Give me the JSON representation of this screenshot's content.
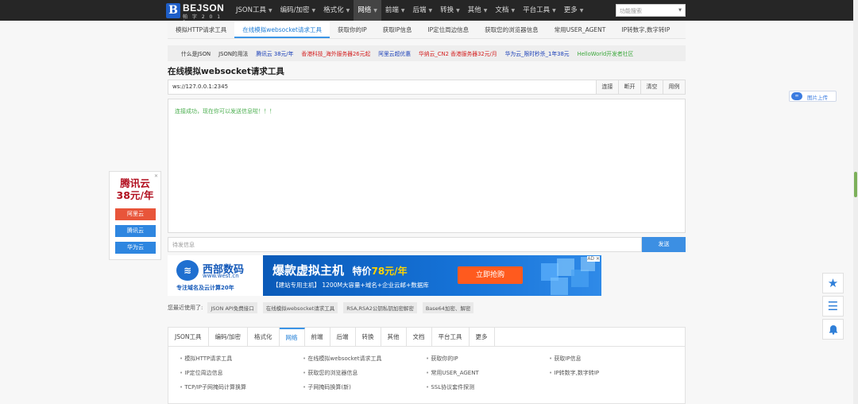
{
  "topnav": {
    "logo_letter": "B",
    "logo_title": "BEJSON",
    "logo_sub": "帕 字 2 0 1 3",
    "menu": [
      {
        "label": "JSON工具",
        "active": false
      },
      {
        "label": "编码/加密",
        "active": false
      },
      {
        "label": "格式化",
        "active": false
      },
      {
        "label": "网络",
        "active": true
      },
      {
        "label": "前端",
        "active": false
      },
      {
        "label": "后端",
        "active": false
      },
      {
        "label": "转换",
        "active": false
      },
      {
        "label": "其他",
        "active": false
      },
      {
        "label": "文档",
        "active": false
      },
      {
        "label": "平台工具",
        "active": false
      },
      {
        "label": "更多",
        "active": false
      }
    ],
    "search_placeholder": "功能搜索"
  },
  "subtabs": [
    {
      "label": "模拟HTTP请求工具",
      "active": false
    },
    {
      "label": "在线模拟websocket请求工具",
      "active": true
    },
    {
      "label": "获取你的IP",
      "active": false
    },
    {
      "label": "获取IP信息",
      "active": false
    },
    {
      "label": "IP定位周边信息",
      "active": false
    },
    {
      "label": "获取您的浏览器信息",
      "active": false
    },
    {
      "label": "常用USER_AGENT",
      "active": false
    },
    {
      "label": "IP转数字,数字转IP",
      "active": false
    }
  ],
  "adbar": [
    {
      "label": "什么是JSON",
      "color": "#333333"
    },
    {
      "label": "JSON的用法",
      "color": "#333333"
    },
    {
      "label": "腾讯云 38元/年",
      "color": "#1a3fb8"
    },
    {
      "label": "香港科技_海外服务器26元起",
      "color": "#d42020"
    },
    {
      "label": "阿里云超优惠",
      "color": "#1a3fb8"
    },
    {
      "label": "华纳云_CN2 香港服务器32元/月",
      "color": "#d42020"
    },
    {
      "label": "华为云_限时秒杀_1年38元",
      "color": "#1a3fb8"
    },
    {
      "label": "HelloWorld开发者社区",
      "color": "#3aa83a"
    }
  ],
  "page_title": "在线模拟websocket请求工具",
  "ws": {
    "url": "ws://127.0.0.1:2345",
    "buttons": [
      "连接",
      "断开",
      "清空",
      "用例"
    ],
    "output": "连接成功，现在你可以发送信息啦！！！",
    "send_placeholder": "待发信息",
    "send_label": "发送"
  },
  "banner": {
    "brand_name": "西部数码",
    "brand_url": "www.west.cn",
    "slogan": "专注域名及云计算20年",
    "headline": "爆款虚拟主机",
    "price_prefix": "特价",
    "price": "78元/年",
    "sub": "【建站专用主机】 1200M大容量+域名+企业云邮+数据库",
    "button": "立即抢购",
    "close": "AD ✕"
  },
  "recent": {
    "label": "您最近使用了:",
    "tags": [
      "JSON API免费接口",
      "在线模拟websocket请求工具",
      "RSA,RSA2公钥私钥加密解密",
      "Base64加密、解密"
    ]
  },
  "bottom": {
    "tabs": [
      {
        "label": "JSON工具",
        "active": false
      },
      {
        "label": "编码/加密",
        "active": false
      },
      {
        "label": "格式化",
        "active": false
      },
      {
        "label": "网络",
        "active": true
      },
      {
        "label": "前端",
        "active": false
      },
      {
        "label": "后端",
        "active": false
      },
      {
        "label": "转换",
        "active": false
      },
      {
        "label": "其他",
        "active": false
      },
      {
        "label": "文档",
        "active": false
      },
      {
        "label": "平台工具",
        "active": false
      },
      {
        "label": "更多",
        "active": false
      }
    ],
    "links": [
      "模拟HTTP请求工具",
      "在线模拟websocket请求工具",
      "获取你的IP",
      "获取IP信息",
      "IP定位周边信息",
      "获取您的浏览器信息",
      "常用USER_AGENT",
      "IP转数字,数字转IP",
      "TCP/IP子网掩码计算换算",
      "子网掩码换算(新)",
      "SSL协议套件探测"
    ]
  },
  "left_ad": {
    "title1": "腾讯云",
    "title2": "38元/年",
    "close": "✕",
    "buttons": [
      {
        "label": "阿里云",
        "color": "#e8553a"
      },
      {
        "label": "腾讯云",
        "color": "#2e86e0"
      },
      {
        "label": "华为云",
        "color": "#2e86e0"
      }
    ]
  },
  "share": {
    "icon": "∞",
    "label": "图片上传"
  },
  "right_icons": [
    "star-icon",
    "menu-icon",
    "bell-icon"
  ]
}
